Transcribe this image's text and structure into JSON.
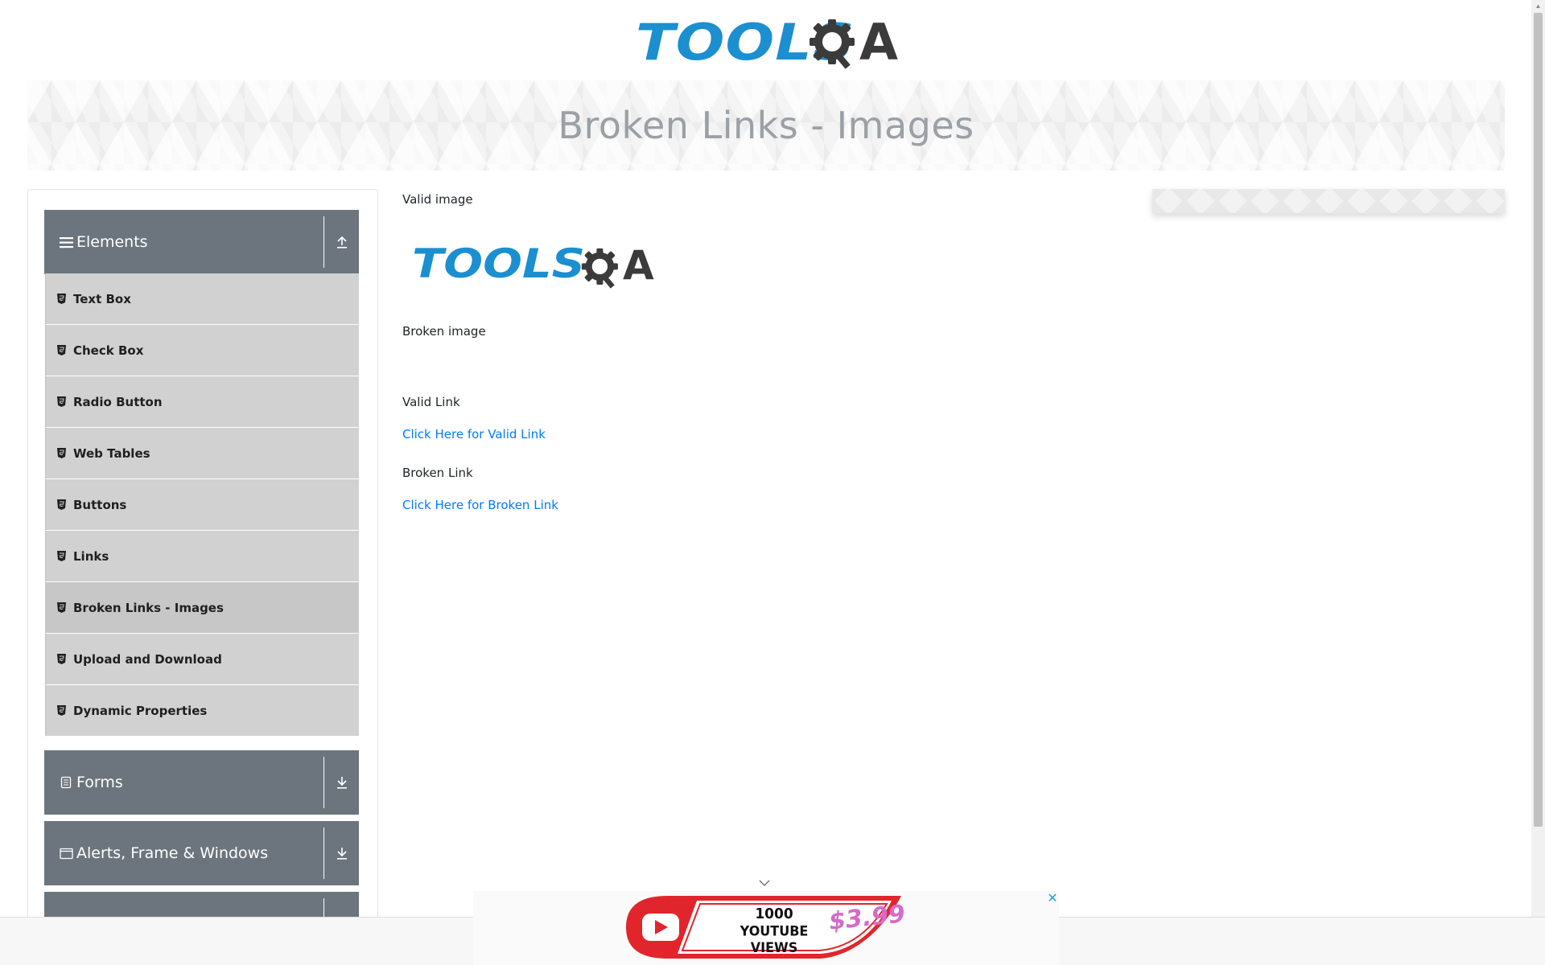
{
  "header": {
    "logo": {
      "tools_text": "TOOLS",
      "qa_text": "A",
      "alt": "TOOLSQA"
    }
  },
  "page": {
    "title": "Broken Links - Images"
  },
  "sidebar": {
    "groups": [
      {
        "label": "Elements",
        "icon": "hamburger-icon",
        "toggle_icon": "arrow-up-icon",
        "expanded": true
      },
      {
        "label": "Forms",
        "icon": "form-icon",
        "toggle_icon": "arrow-down-icon",
        "expanded": false
      },
      {
        "label": "Alerts, Frame & Windows",
        "icon": "window-icon",
        "toggle_icon": "arrow-down-icon",
        "expanded": false
      }
    ],
    "items": [
      {
        "label": "Text Box",
        "icon": "html5-icon"
      },
      {
        "label": "Check Box",
        "icon": "html5-icon"
      },
      {
        "label": "Radio Button",
        "icon": "html5-icon"
      },
      {
        "label": "Web Tables",
        "icon": "html5-icon"
      },
      {
        "label": "Buttons",
        "icon": "html5-icon"
      },
      {
        "label": "Links",
        "icon": "html5-icon"
      },
      {
        "label": "Broken Links - Images",
        "icon": "html5-icon",
        "active": true
      },
      {
        "label": "Upload and Download",
        "icon": "html5-icon"
      },
      {
        "label": "Dynamic Properties",
        "icon": "html5-icon"
      }
    ]
  },
  "content": {
    "valid_image_label": "Valid image",
    "broken_image_label": "Broken image",
    "valid_link_label": "Valid Link",
    "valid_link_text": "Click Here for Valid Link",
    "broken_link_label": "Broken Link",
    "broken_link_text": "Click Here for Broken Link"
  },
  "ad": {
    "views_line1": "1000",
    "views_line2": "YOUTUBE VIEWS",
    "price": "$3.99",
    "close_icon": "close-icon"
  },
  "colors": {
    "brand_blue": "#1b8fd0",
    "sidebar_header": "#6c757d",
    "sidebar_item": "#d1d1d1",
    "link": "#007bff"
  }
}
